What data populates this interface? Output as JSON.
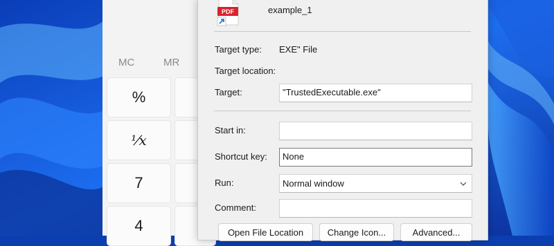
{
  "calculator": {
    "memory": [
      "MC",
      "MR"
    ],
    "keys": [
      "%",
      "⅟x",
      "7",
      "4"
    ]
  },
  "file": {
    "name": "example_1",
    "icon_badge": "PDF",
    "brand_color": "#d9232e"
  },
  "properties": {
    "target_type": {
      "label": "Target type:",
      "value": "EXE\" File"
    },
    "target_location": {
      "label": "Target location:",
      "value": ""
    },
    "target": {
      "label": "Target:",
      "value": "\"TrustedExecutable.exe\""
    },
    "start_in": {
      "label": "Start in:",
      "value": ""
    },
    "shortcut_key": {
      "label": "Shortcut key:",
      "value": "None"
    },
    "run": {
      "label": "Run:",
      "value": "Normal window"
    },
    "comment": {
      "label": "Comment:",
      "value": ""
    }
  },
  "buttons": {
    "open_file_location": "Open File Location",
    "change_icon": "Change Icon...",
    "advanced": "Advanced..."
  }
}
